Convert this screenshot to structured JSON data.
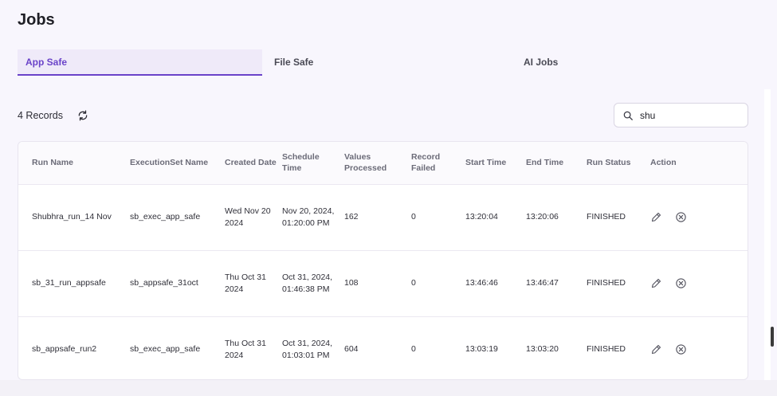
{
  "page": {
    "title": "Jobs"
  },
  "tabs": [
    {
      "label": "App Safe",
      "active": true
    },
    {
      "label": "File Safe",
      "active": false
    },
    {
      "label": "AI Jobs",
      "active": false
    }
  ],
  "records": {
    "count_label": "4 Records"
  },
  "search": {
    "value": "shu"
  },
  "table": {
    "headers": [
      "Run Name",
      "ExecutionSet Name",
      "Created Date",
      "Schedule Time",
      "Values Processed",
      "Record Failed",
      "Start Time",
      "End Time",
      "Run Status",
      "Action"
    ],
    "rows": [
      {
        "run_name": "Shubhra_run_14 Nov",
        "execution_set": "sb_exec_app_safe",
        "created_date": "Wed Nov 20 2024",
        "schedule_time": "Nov 20, 2024, 01:20:00 PM",
        "values_processed": "162",
        "record_failed": "0",
        "start_time": "13:20:04",
        "end_time": "13:20:06",
        "run_status": "FINISHED"
      },
      {
        "run_name": "sb_31_run_appsafe",
        "execution_set": "sb_appsafe_31oct",
        "created_date": "Thu Oct 31 2024",
        "schedule_time": "Oct 31, 2024, 01:46:38 PM",
        "values_processed": "108",
        "record_failed": "0",
        "start_time": "13:46:46",
        "end_time": "13:46:47",
        "run_status": "FINISHED"
      },
      {
        "run_name": "sb_appsafe_run2",
        "execution_set": "sb_exec_app_safe",
        "created_date": "Thu Oct 31 2024",
        "schedule_time": "Oct 31, 2024, 01:03:01 PM",
        "values_processed": "604",
        "record_failed": "0",
        "start_time": "13:03:19",
        "end_time": "13:03:20",
        "run_status": "FINISHED"
      }
    ]
  },
  "icons": {
    "refresh": "refresh-icon",
    "search": "search-icon",
    "edit": "pencil-icon",
    "cancel": "cancel-circle-icon"
  },
  "colors": {
    "accent": "#6a43c9",
    "background": "#f8f6fd"
  }
}
